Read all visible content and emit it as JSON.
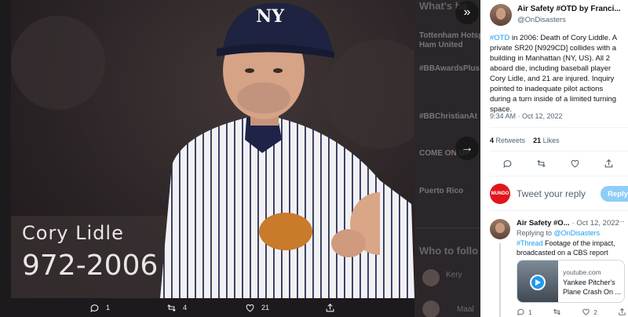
{
  "background": {
    "heading": "What's ha",
    "trend1": "Tottenham Hotsp",
    "trend1b": "Ham United",
    "trend2": "#BBAwardsPlus",
    "trend3": "#BBChristianAt",
    "trend4": "COME ON UP",
    "trend5": "Puerto Rico",
    "who_to_follow": "Who to follo",
    "follow1": "Kery",
    "follow2": "Maal"
  },
  "photo": {
    "caption_name": "Cory Lidle",
    "caption_years": "972-2006"
  },
  "media_actions": {
    "replies": "1",
    "retweets": "4",
    "likes": "21"
  },
  "tweet": {
    "author_name": "Air Safety #OTD by Franci...",
    "author_handle": "@OnDisasters",
    "hashtag": "#OTD",
    "text": " in 2006: Death of Cory Liddle. A private SR20 [N929CD] collides with a building in Manhattan (NY, US). All 2 aboard die, including baseball player Cory Lidle, and 21 are injured. Inquiry pointed to inadequate pilot actions during a turn inside of a limited turning space.",
    "timestamp": "9:34 AM · Oct 12, 2022",
    "retweets_count": "4",
    "retweets_label": "Retweets",
    "likes_count": "21",
    "likes_label": "Likes"
  },
  "reply_box": {
    "logo_text": "MUNDO",
    "placeholder": "Tweet your reply",
    "button": "Reply"
  },
  "reply": {
    "name": "Air Safety #O...",
    "date": "· Oct 12, 2022",
    "more": "···",
    "replying_prefix": "Replying to ",
    "replying_handle": "@OnDisasters",
    "hashtag": "#Thread",
    "text": " Footage of the impact, broadcasted on a CBS report",
    "card_domain": "youtube.com",
    "card_title": "Yankee Pitcher's Plane Crash On ...",
    "replies": "1",
    "likes": "2"
  },
  "colors": {
    "accent": "#1d9bf0",
    "reply_button": "#8ecdf8",
    "mundo_red": "#e0161c"
  }
}
